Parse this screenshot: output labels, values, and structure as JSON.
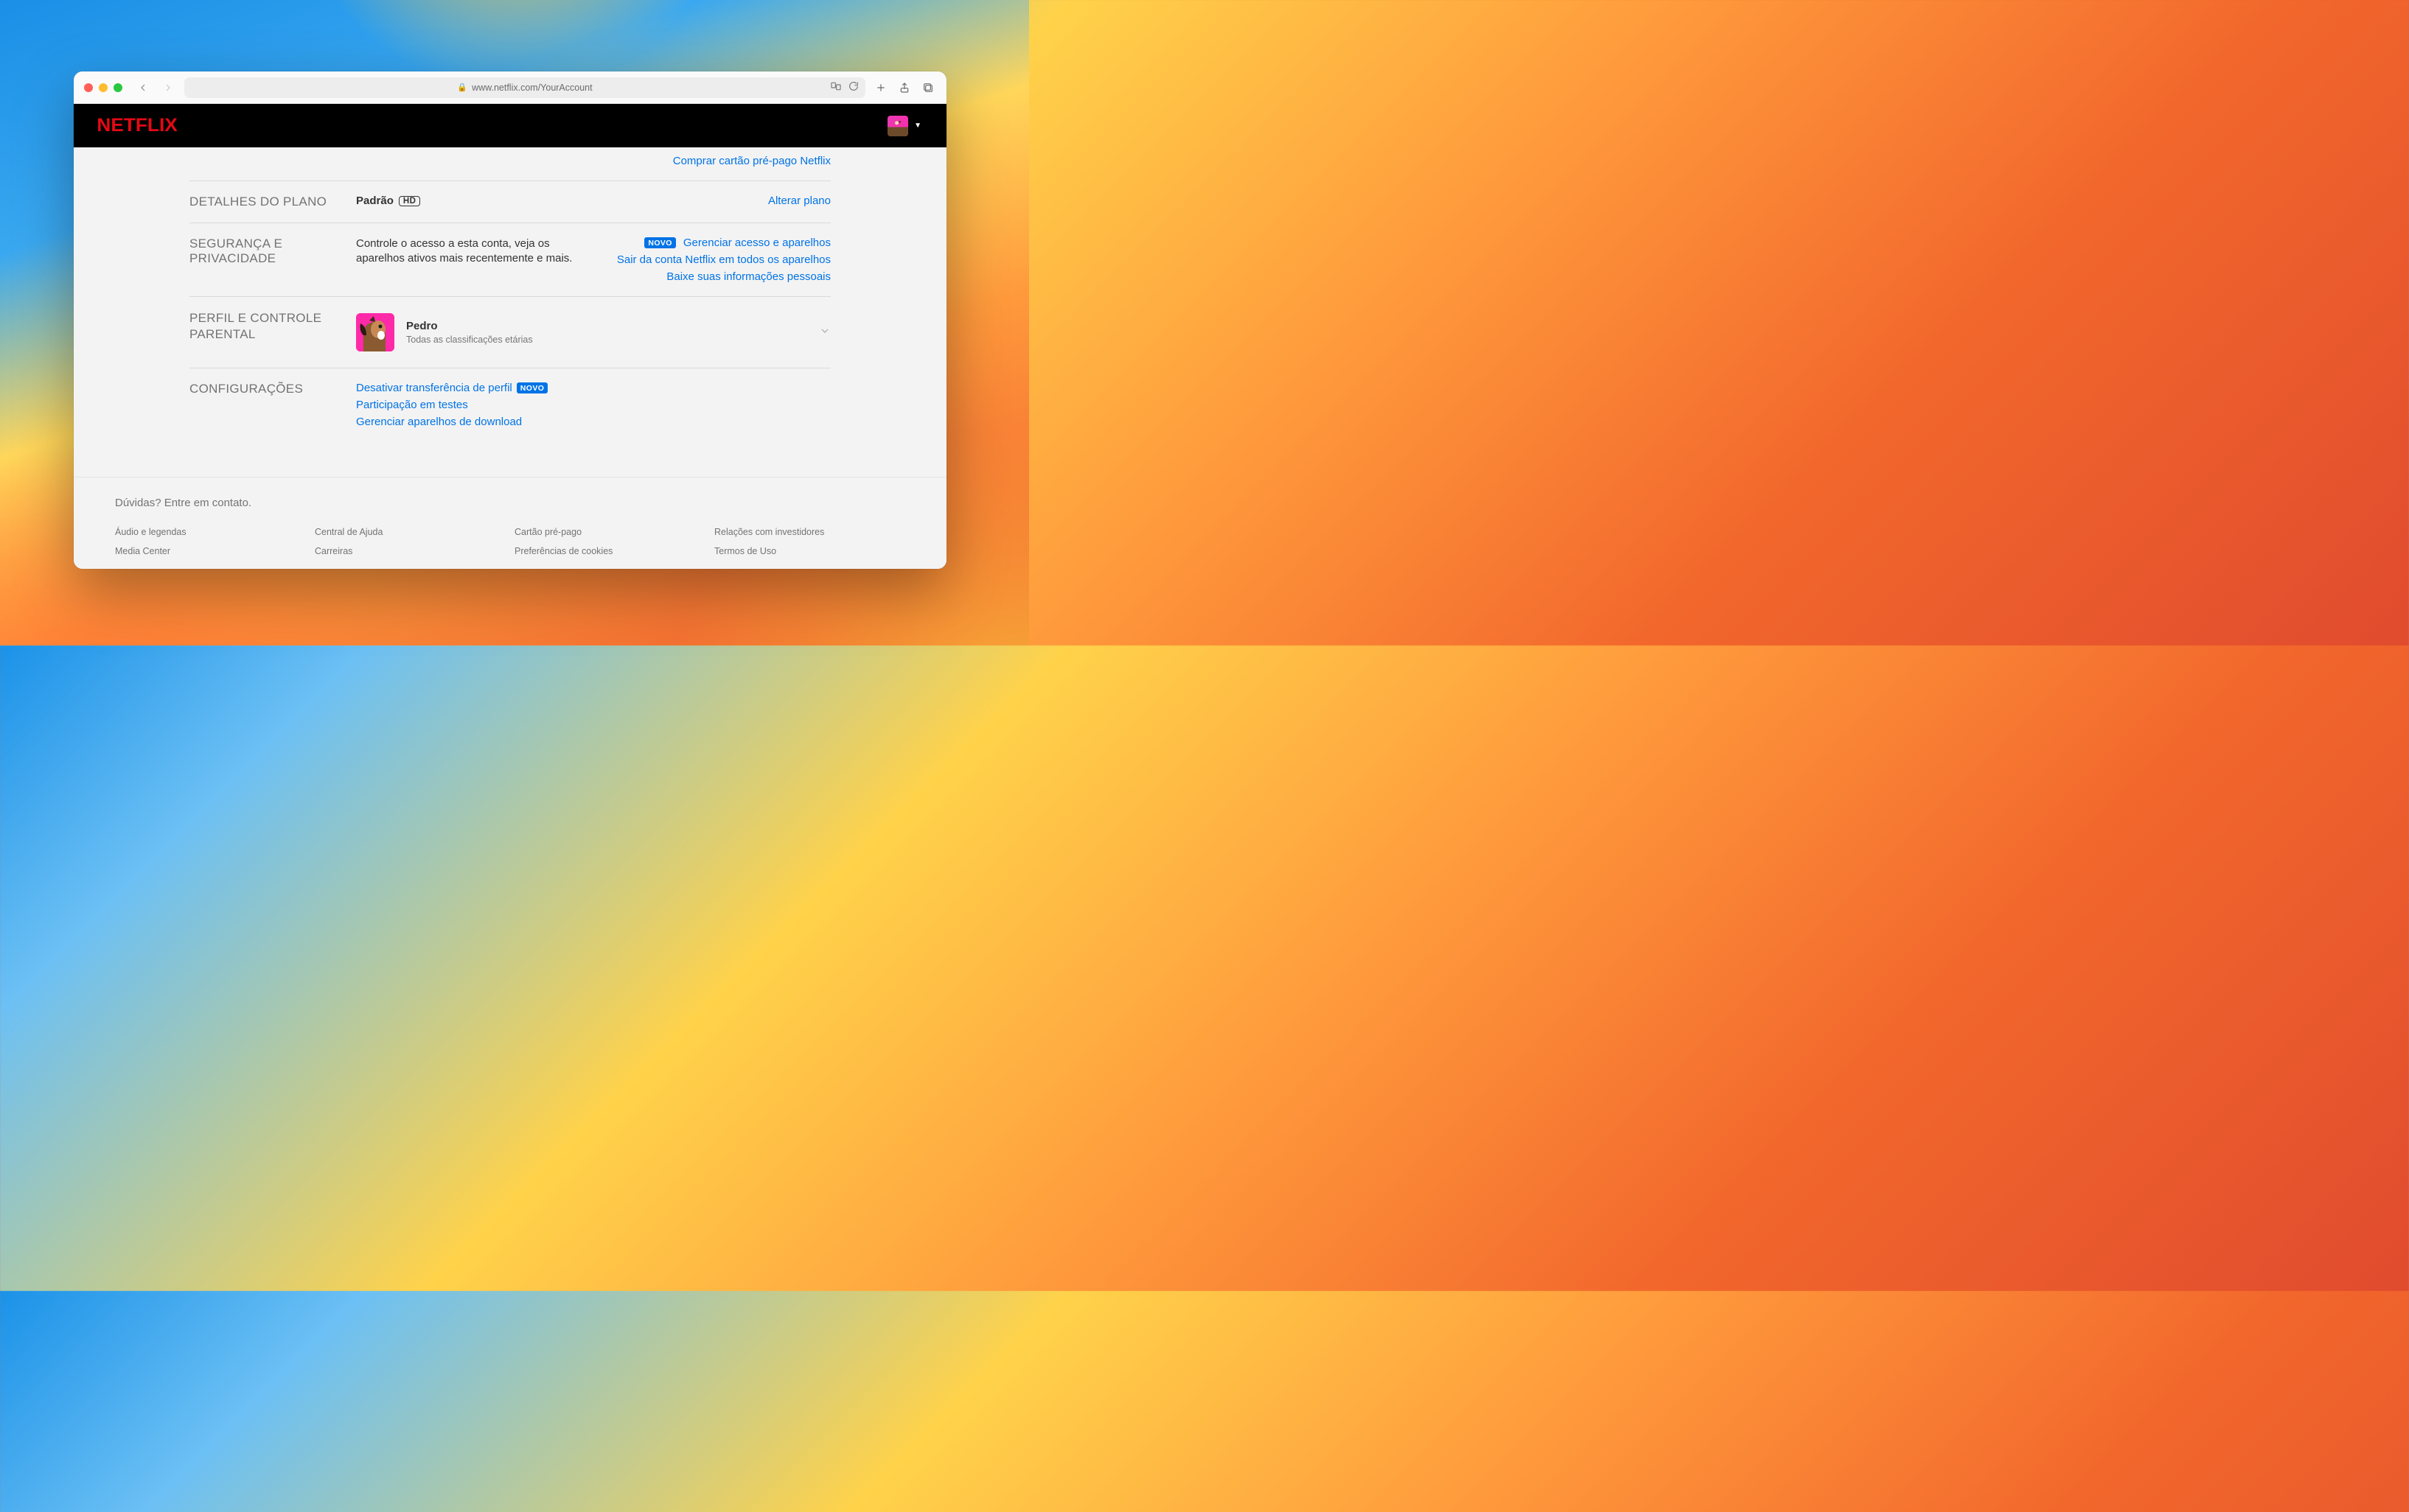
{
  "browser": {
    "url": "www.netflix.com/YourAccount"
  },
  "header": {
    "logo_text": "NETFLIX"
  },
  "top_links": {
    "buy_gift_card": "Comprar cartão pré-pago Netflix"
  },
  "plan": {
    "section_label": "DETALHES DO PLANO",
    "name": "Padrão",
    "quality_badge": "HD",
    "change_link": "Alterar plano"
  },
  "security": {
    "section_label": "SEGURANÇA E PRIVACIDADE",
    "description": "Controle o acesso a esta conta, veja os aparelhos ativos mais recentemente e mais.",
    "novo_badge": "NOVO",
    "links": {
      "manage_access": "Gerenciar acesso e aparelhos",
      "sign_out_all": "Sair da conta Netflix em todos os aparelhos",
      "download_info": "Baixe suas informações pessoais"
    }
  },
  "profile": {
    "section_label": "PERFIL E CONTROLE PARENTAL",
    "name": "Pedro",
    "rating": "Todas as classificações etárias"
  },
  "settings": {
    "section_label": "CONFIGURAÇÕES",
    "novo_badge": "NOVO",
    "links": {
      "disable_transfer": "Desativar transferência de perfil",
      "test_participation": "Participação em testes",
      "manage_download_devices": "Gerenciar aparelhos de download"
    }
  },
  "footer": {
    "contact": "Dúvidas? Entre em contato.",
    "cols": [
      [
        "Áudio e legendas",
        "Media Center"
      ],
      [
        "Central de Ajuda",
        "Carreiras"
      ],
      [
        "Cartão pré-pago",
        "Preferências de cookies"
      ],
      [
        "Relações com investidores",
        "Termos de Uso"
      ]
    ]
  }
}
